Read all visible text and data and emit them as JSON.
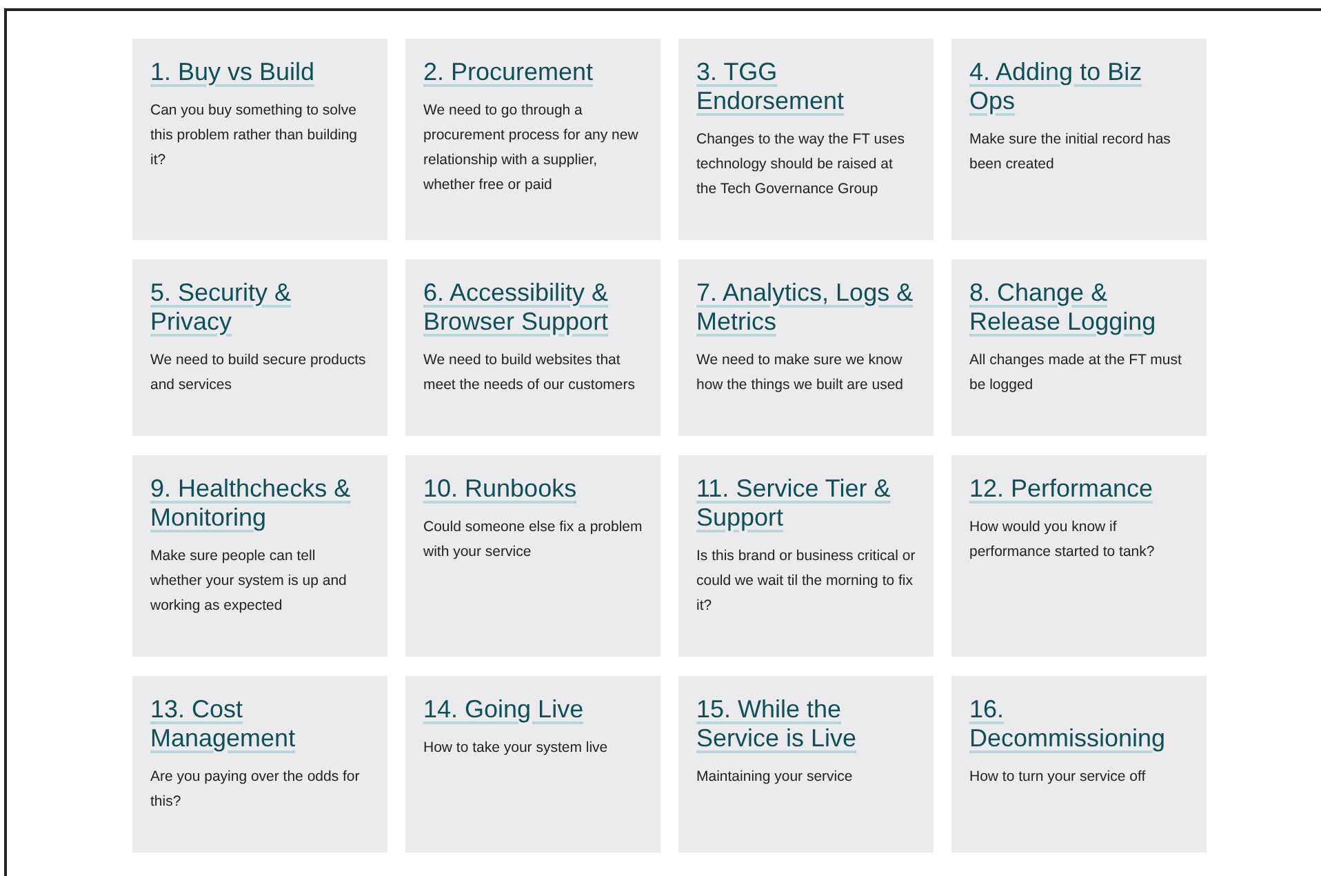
{
  "cards": [
    {
      "title": "1. Buy vs Build",
      "description": "Can you buy something to solve this problem rather than building it?"
    },
    {
      "title": "2. Procurement",
      "description": "We need to go through a procurement process for any new relationship with a supplier, whether free or paid"
    },
    {
      "title": "3. TGG Endorsement",
      "description": "Changes to the way the FT uses technology should be raised at the Tech Governance Group"
    },
    {
      "title": "4. Adding to Biz Ops",
      "description": "Make sure the initial record has been created"
    },
    {
      "title": "5. Security & Privacy",
      "description": "We need to build secure products and services"
    },
    {
      "title": "6. Accessibility & Browser Support",
      "description": "We need to build websites that meet the needs of our customers"
    },
    {
      "title": "7. Analytics, Logs & Metrics",
      "description": "We need to make sure we know how the things we built are used"
    },
    {
      "title": "8. Change & Release Logging",
      "description": "All changes made at the FT must be logged"
    },
    {
      "title": "9. Healthchecks & Monitoring",
      "description": "Make sure people can tell whether your system is up and working as expected"
    },
    {
      "title": "10. Runbooks",
      "description": "Could someone else fix a problem with your service"
    },
    {
      "title": "11. Service Tier & Support",
      "description": "Is this brand or business critical or could we wait til the morning to fix it?"
    },
    {
      "title": "12. Performance",
      "description": "How would you know if performance started to tank?"
    },
    {
      "title": "13. Cost Management",
      "description": "Are you paying over the odds for this?"
    },
    {
      "title": "14. Going Live",
      "description": "How to take your system live"
    },
    {
      "title": "15. While the Service is Live",
      "description": "Maintaining your service"
    },
    {
      "title": "16. Decommissioning",
      "description": "How to turn your service off"
    }
  ]
}
